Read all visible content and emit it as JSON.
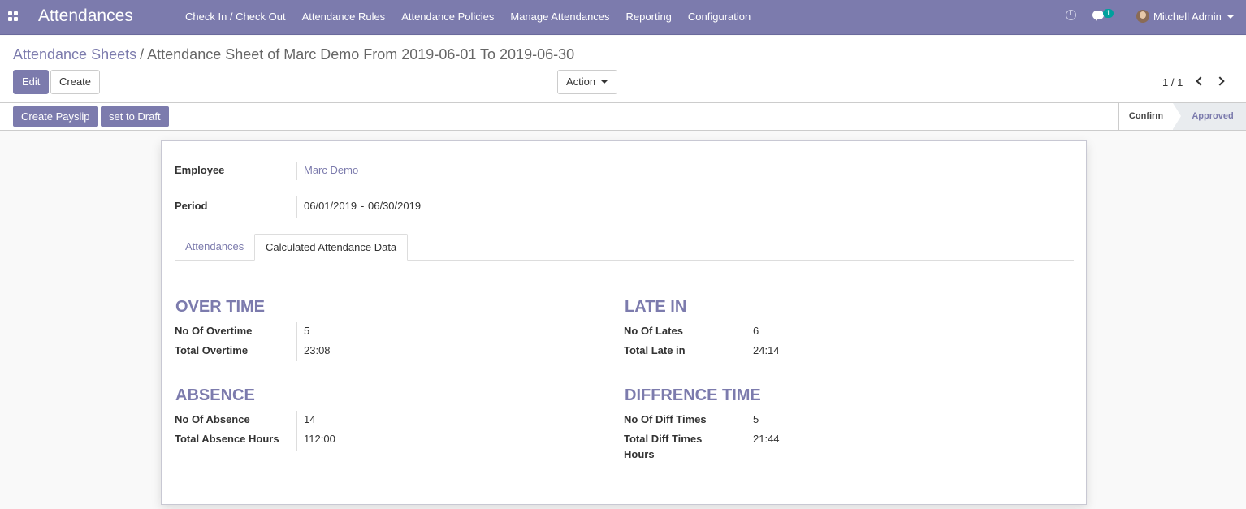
{
  "navbar": {
    "app_title": "Attendances",
    "menu": [
      "Check In / Check Out",
      "Attendance Rules",
      "Attendance Policies",
      "Manage Attendances",
      "Reporting",
      "Configuration"
    ],
    "chat_badge": "1",
    "user_name": "Mitchell Admin"
  },
  "breadcrumb": {
    "parent": "Attendance Sheets",
    "separator": "/",
    "current": "Attendance Sheet of Marc Demo From 2019-06-01 To 2019-06-30"
  },
  "buttons": {
    "edit": "Edit",
    "create": "Create",
    "action": "Action"
  },
  "pager": {
    "value": "1 / 1"
  },
  "statusbar": {
    "create_payslip": "Create Payslip",
    "set_to_draft": "set to Draft",
    "stages": [
      "Confirm",
      "Approved"
    ]
  },
  "form": {
    "employee_label": "Employee",
    "employee_value": "Marc Demo",
    "period_label": "Period",
    "period_start": "06/01/2019",
    "period_sep": "-",
    "period_end": "06/30/2019",
    "tabs": [
      "Attendances",
      "Calculated Attendance Data"
    ],
    "overtime": {
      "title": "OVER TIME",
      "count_label": "No Of Overtime",
      "count_value": "5",
      "total_label": "Total Overtime",
      "total_value": "23:08"
    },
    "late_in": {
      "title": "LATE IN",
      "count_label": "No Of Lates",
      "count_value": "6",
      "total_label": "Total Late in",
      "total_value": "24:14"
    },
    "absence": {
      "title": "ABSENCE",
      "count_label": "No Of Absence",
      "count_value": "14",
      "total_label": "Total Absence Hours",
      "total_value": "112:00"
    },
    "diff_time": {
      "title": "DIFFRENCE TIME",
      "count_label": "No Of Diff Times",
      "count_value": "5",
      "total_label_line1": "Total Diff Times",
      "total_label_line2": "Hours",
      "total_value": "21:44"
    }
  }
}
